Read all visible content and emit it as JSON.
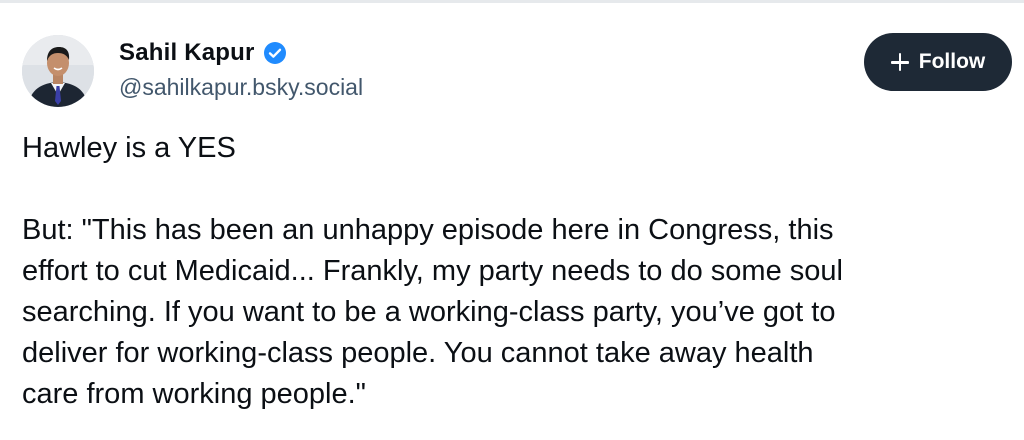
{
  "author": {
    "display_name": "Sahil Kapur",
    "handle": "@sahilkapur.bsky.social",
    "verified_icon": "verified-check-icon",
    "avatar_icon": "avatar"
  },
  "follow_button": {
    "label": "Follow",
    "icon": "plus-icon"
  },
  "post": {
    "lines": [
      "Hawley is a YES",
      "",
      "But: \"This has been an unhappy episode here in Congress, this",
      "effort to cut Medicaid... Frankly, my party needs to do some soul",
      "searching. If you want to be a working-class party, you’ve got to",
      "deliver for working-class people. You cannot take away health",
      "care from working people.\""
    ]
  },
  "colors": {
    "follow_button_bg": "#1e2936",
    "verified_badge": "#208bfe",
    "handle_text": "#42576c",
    "body_text": "#0b0f14"
  }
}
